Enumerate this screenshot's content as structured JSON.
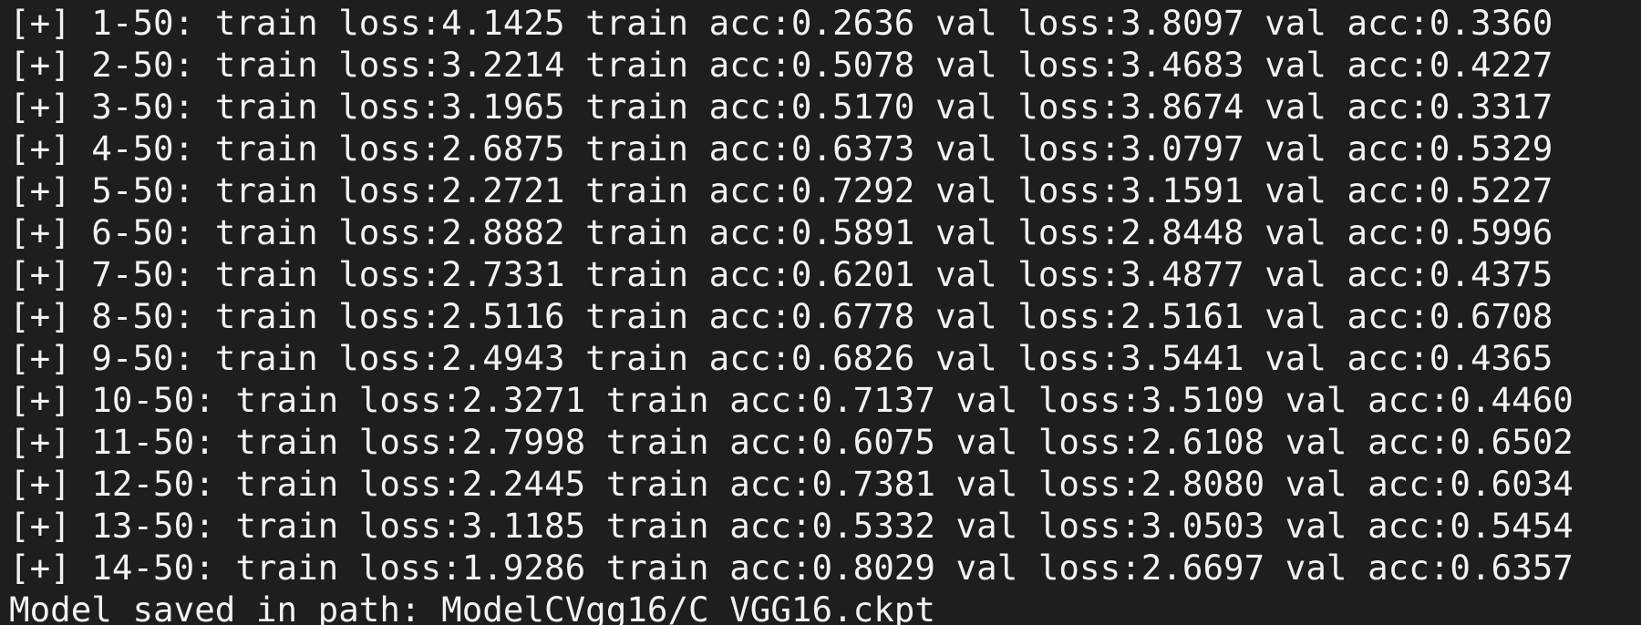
{
  "terminal": {
    "lines": [
      "[+] 1-50: train loss:4.1425 train acc:0.2636 val loss:3.8097 val acc:0.3360",
      "[+] 2-50: train loss:3.2214 train acc:0.5078 val loss:3.4683 val acc:0.4227",
      "[+] 3-50: train loss:3.1965 train acc:0.5170 val loss:3.8674 val acc:0.3317",
      "[+] 4-50: train loss:2.6875 train acc:0.6373 val loss:3.0797 val acc:0.5329",
      "[+] 5-50: train loss:2.2721 train acc:0.7292 val loss:3.1591 val acc:0.5227",
      "[+] 6-50: train loss:2.8882 train acc:0.5891 val loss:2.8448 val acc:0.5996",
      "[+] 7-50: train loss:2.7331 train acc:0.6201 val loss:3.4877 val acc:0.4375",
      "[+] 8-50: train loss:2.5116 train acc:0.6778 val loss:2.5161 val acc:0.6708",
      "[+] 9-50: train loss:2.4943 train acc:0.6826 val loss:3.5441 val acc:0.4365",
      "[+] 10-50: train loss:2.3271 train acc:0.7137 val loss:3.5109 val acc:0.4460",
      "[+] 11-50: train loss:2.7998 train acc:0.6075 val loss:2.6108 val acc:0.6502",
      "[+] 12-50: train loss:2.2445 train acc:0.7381 val loss:2.8080 val acc:0.6034",
      "[+] 13-50: train loss:3.1185 train acc:0.5332 val loss:3.0503 val acc:0.5454",
      "[+] 14-50: train loss:1.9286 train acc:0.8029 val loss:2.6697 val acc:0.6357",
      "Model saved in path: ModelCVgg16/C_VGG16.ckpt"
    ]
  },
  "colors": {
    "background": "#1e1e1e",
    "text": "#f2f2f2"
  }
}
